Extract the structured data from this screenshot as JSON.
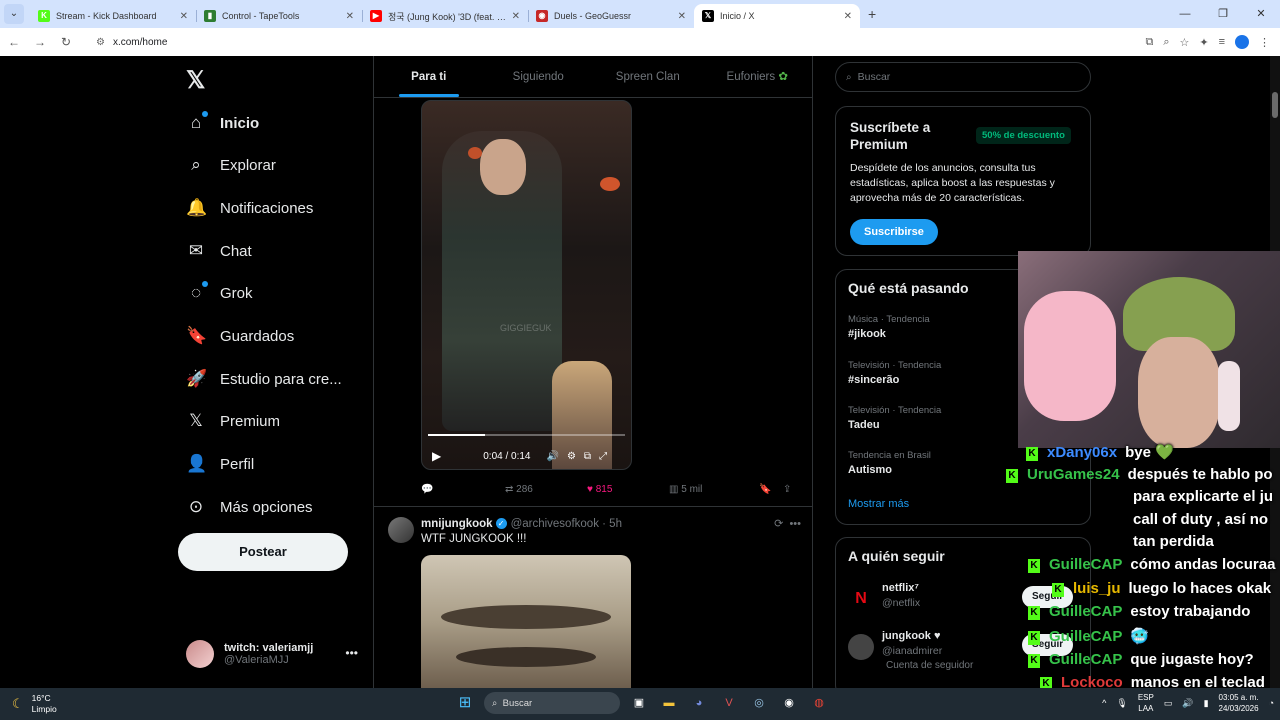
{
  "browser": {
    "tabs": [
      {
        "title": "Stream - Kick Dashboard",
        "favicon": "kick-icon",
        "color": "#53fc18",
        "glyph": "K",
        "active": false
      },
      {
        "title": "Control - TapeTools",
        "favicon": "tapetools-icon",
        "color": "#2e7d32",
        "glyph": "▮",
        "active": false
      },
      {
        "title": "정국 (Jung Kook) '3D (feat. Jack",
        "favicon": "youtube-icon",
        "color": "#ff0000",
        "glyph": "▶",
        "active": false
      },
      {
        "title": "Duels - GeoGuessr",
        "favicon": "geoguessr-icon",
        "color": "#c62828",
        "glyph": "◉",
        "active": false
      },
      {
        "title": "Inicio / X",
        "favicon": "x-icon",
        "color": "#000000",
        "glyph": "𝕏",
        "active": true
      }
    ],
    "url": "x.com/home"
  },
  "x": {
    "nav": [
      {
        "label": "Inicio",
        "icon": "home-icon",
        "glyph": "⌂",
        "active": true,
        "dot": true
      },
      {
        "label": "Explorar",
        "icon": "search-icon",
        "glyph": "⌕",
        "active": false,
        "dot": false
      },
      {
        "label": "Notificaciones",
        "icon": "bell-icon",
        "glyph": "🔔",
        "active": false,
        "dot": false
      },
      {
        "label": "Chat",
        "icon": "mail-icon",
        "glyph": "✉",
        "active": false,
        "dot": false
      },
      {
        "label": "Grok",
        "icon": "grok-icon",
        "glyph": "◌",
        "active": false,
        "dot": true
      },
      {
        "label": "Guardados",
        "icon": "bookmark-icon",
        "glyph": "🔖",
        "active": false,
        "dot": false
      },
      {
        "label": "Estudio para cre...",
        "icon": "rocket-icon",
        "glyph": "🚀",
        "active": false,
        "dot": false
      },
      {
        "label": "Premium",
        "icon": "x-logo-icon",
        "glyph": "𝕏",
        "active": false,
        "dot": false
      },
      {
        "label": "Perfil",
        "icon": "person-icon",
        "glyph": "👤",
        "active": false,
        "dot": false
      },
      {
        "label": "Más opciones",
        "icon": "more-circle-icon",
        "glyph": "⊙",
        "active": false,
        "dot": false
      }
    ],
    "post_button": "Postear",
    "account": {
      "name": "twitch: valeriamjj",
      "handle": "@ValeriaMJJ"
    },
    "timeline_tabs": [
      "Para ti",
      "Siguiendo",
      "Spreen Clan",
      "Eufoniers"
    ],
    "video": {
      "time": "0:04 / 0:14",
      "progress": 0.29,
      "watermark": "GIGGIEGUK"
    },
    "actions": {
      "retweets": "286",
      "likes": "815",
      "views": "5 mil"
    },
    "post2": {
      "name": "mnijungkook",
      "handle": "@archivesofkook",
      "time": "· 5h",
      "text": "WTF JUNGKOOK !!!"
    },
    "search_placeholder": "Buscar",
    "premium": {
      "title": "Suscríbete a Premium",
      "badge": "50% de descuento",
      "desc": "Despídete de los anuncios, consulta tus estadísticas, aplica boost a las respuestas y aprovecha más de 20 características.",
      "button": "Suscribirse"
    },
    "trends_title": "Qué está pasando",
    "trends": [
      {
        "meta": "Música · Tendencia",
        "topic": "#jikook"
      },
      {
        "meta": "Televisión · Tendencia",
        "topic": "#sincerão"
      },
      {
        "meta": "Televisión · Tendencia",
        "topic": "Tadeu"
      },
      {
        "meta": "Tendencia en Brasil",
        "topic": "Autismo"
      }
    ],
    "trends_more": "Mostrar más",
    "follow_title": "A quién seguir",
    "follow": [
      {
        "name": "netflix⁷",
        "handle": "@netflix",
        "note": "",
        "button": "Seguir",
        "color": "#000"
      },
      {
        "name": "jungkook ♥",
        "handle": "@ianadmirer",
        "note": "Cuenta de seguidor",
        "button": "Seguir",
        "color": "#444"
      }
    ]
  },
  "chat": [
    {
      "user": "xDany06x",
      "color": "#3d8bff",
      "msg": "bye 💚"
    },
    {
      "user": "UruGames24",
      "color": "#36c24a",
      "msg": "después te hablo po"
    },
    {
      "user": "",
      "color": "#ffffff",
      "msg": "para explicarte el ju"
    },
    {
      "user": "",
      "color": "#ffffff",
      "msg": "call of duty , así no"
    },
    {
      "user": "",
      "color": "#ffffff",
      "msg": "tan perdida"
    },
    {
      "user": "GuilleCAP",
      "color": "#36c24a",
      "msg": "cómo andas locuraa"
    },
    {
      "user": "luis_ju",
      "color": "#e6b800",
      "msg": "luego lo haces okak"
    },
    {
      "user": "GuilleCAP",
      "color": "#36c24a",
      "msg": "estoy trabajando"
    },
    {
      "user": "GuilleCAP",
      "color": "#36c24a",
      "msg": "🥶"
    },
    {
      "user": "GuilleCAP",
      "color": "#36c24a",
      "msg": "que jugaste hoy?"
    },
    {
      "user": "Lockoco",
      "color": "#e03a3a",
      "msg": "manos en el teclad"
    }
  ],
  "taskbar": {
    "weather_temp": "16°C",
    "weather_desc": "Limpio",
    "search": "Buscar",
    "lang1": "ESP",
    "lang2": "LAA",
    "time": "03:05 a. m.",
    "date": "24/03/2026"
  }
}
